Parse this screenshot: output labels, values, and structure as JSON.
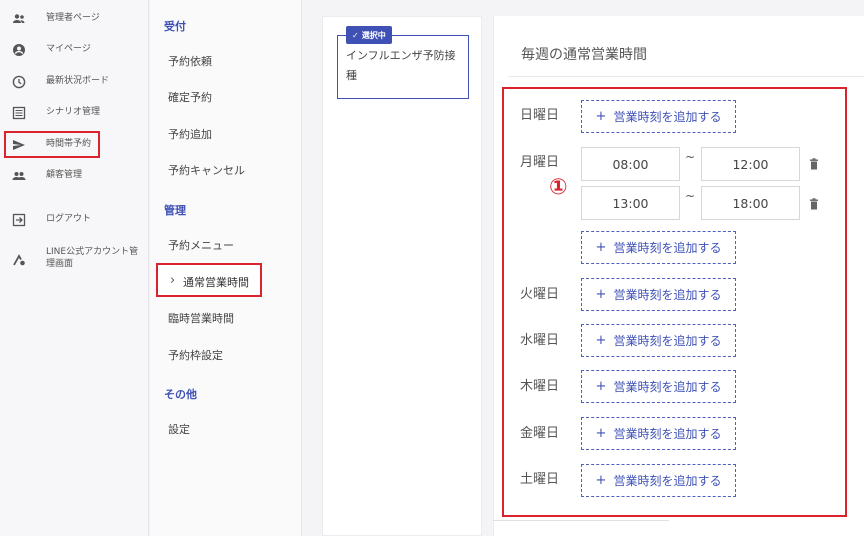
{
  "sidebar": {
    "items": [
      {
        "label": "管理者ページ",
        "icon": "people-icon"
      },
      {
        "label": "マイページ",
        "icon": "account-circle-icon"
      },
      {
        "label": "最新状況ボード",
        "icon": "clock-icon"
      },
      {
        "label": "シナリオ管理",
        "icon": "list-icon"
      },
      {
        "label": "時間帯予約",
        "icon": "send-icon"
      },
      {
        "label": "顧客管理",
        "icon": "people-icon"
      },
      {
        "label": "ログアウト",
        "icon": "logout-icon"
      },
      {
        "label": "LINE公式アカウント管理画面",
        "icon": "line-settings-icon"
      }
    ]
  },
  "submenu": {
    "sections": [
      {
        "heading": "受付",
        "items": [
          "予約依頼",
          "確定予約",
          "予約追加",
          "予約キャンセル"
        ]
      },
      {
        "heading": "管理",
        "items": [
          "予約メニュー",
          "通常営業時間",
          "臨時営業時間",
          "予約枠設定"
        ]
      },
      {
        "heading": "その他",
        "items": [
          "設定"
        ]
      }
    ],
    "active": "通常営業時間"
  },
  "plan": {
    "badge": "選択中",
    "name": "インフルエンザ予防接種"
  },
  "schedule": {
    "title": "毎週の通常営業時間",
    "marker": "①",
    "add_label": "営業時刻を追加する",
    "tilde": "~",
    "days": [
      {
        "name": "日曜日",
        "slots": []
      },
      {
        "name": "月曜日",
        "slots": [
          [
            "08:00",
            "12:00"
          ],
          [
            "13:00",
            "18:00"
          ]
        ]
      },
      {
        "name": "火曜日",
        "slots": []
      },
      {
        "name": "水曜日",
        "slots": []
      },
      {
        "name": "木曜日",
        "slots": []
      },
      {
        "name": "金曜日",
        "slots": []
      },
      {
        "name": "土曜日",
        "slots": []
      }
    ]
  },
  "colors": {
    "accent": "#3f51b5",
    "highlight": "#d9232d"
  }
}
